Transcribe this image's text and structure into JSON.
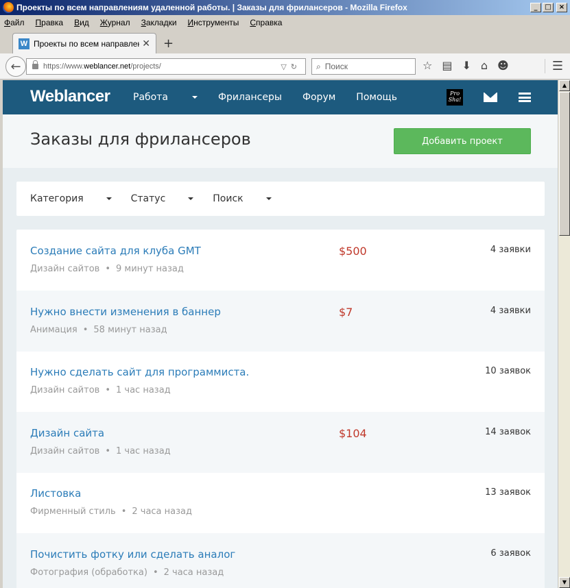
{
  "window": {
    "title": "Проекты по всем направлениям удаленной работы. | Заказы для фрилансеров - Mozilla Firefox"
  },
  "menubar": [
    "Файл",
    "Правка",
    "Вид",
    "Журнал",
    "Закладки",
    "Инструменты",
    "Справка"
  ],
  "tab": {
    "favicon": "W",
    "label": "Проекты по всем направлен…"
  },
  "urlbar": {
    "prefix": "https://www.",
    "host": "weblancer.net",
    "path": "/projects/"
  },
  "searchbar": {
    "placeholder": "Поиск"
  },
  "site": {
    "logo": "Weblancer",
    "nav": [
      "Работа",
      "Фрилансеры",
      "Форум",
      "Помощь"
    ],
    "proshot_line1": "Pro",
    "proshot_line2": "Sha!"
  },
  "page": {
    "title": "Заказы для фрилансеров",
    "add_button": "Добавить проект"
  },
  "filters": [
    "Категория",
    "Статус",
    "Поиск"
  ],
  "projects": [
    {
      "title": "Создание сайта для клуба GMT",
      "category": "Дизайн сайтов",
      "time": "9 минут назад",
      "price": "$500",
      "bids": "4 заявки"
    },
    {
      "title": "Нужно внести изменения в баннер",
      "category": "Анимация",
      "time": "58 минут назад",
      "price": "$7",
      "bids": "4 заявки"
    },
    {
      "title": "Нужно сделать сайт для программиста.",
      "category": "Дизайн сайтов",
      "time": "1 час назад",
      "price": "",
      "bids": "10 заявок"
    },
    {
      "title": "Дизайн сайта",
      "category": "Дизайн сайтов",
      "time": "1 час назад",
      "price": "$104",
      "bids": "14 заявок"
    },
    {
      "title": "Листовка",
      "category": "Фирменный стиль",
      "time": "2 часа назад",
      "price": "",
      "bids": "13 заявок"
    },
    {
      "title": "Почистить фотку или сделать аналог",
      "category": "Фотография (обработка)",
      "time": "2 часа назад",
      "price": "",
      "bids": "6 заявок"
    }
  ]
}
